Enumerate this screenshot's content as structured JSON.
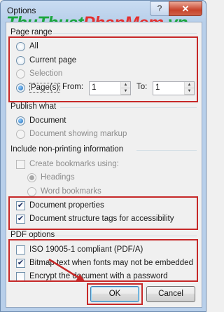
{
  "window": {
    "title": "Options",
    "help_glyph": "?",
    "close_glyph": "✕",
    "watermark_part1": "ThuThuat",
    "watermark_part2": "PhanMem",
    "watermark_part3": ".vn"
  },
  "page_range": {
    "title": "Page range",
    "all_label": "All",
    "current_page_label": "Current page",
    "selection_label": "Selection",
    "pages_label": "Page(s)",
    "from_label": "From:",
    "from_value": "1",
    "to_label": "To:",
    "to_value": "1",
    "selected": "pages"
  },
  "publish_what": {
    "title": "Publish what",
    "document_label": "Document",
    "markup_label": "Document showing markup"
  },
  "non_printing": {
    "title": "Include non-printing information",
    "bookmarks_label": "Create bookmarks using:",
    "headings_label": "Headings",
    "word_bookmarks_label": "Word bookmarks",
    "doc_properties_label": "Document properties",
    "doc_properties_checked": true,
    "structure_tags_label": "Document structure tags for accessibility",
    "structure_tags_checked": true
  },
  "pdf_options": {
    "title": "PDF options",
    "iso_label": "ISO 19005-1 compliant (PDF/A)",
    "iso_checked": false,
    "bitmap_label": "Bitmap text when fonts may not be embedded",
    "bitmap_checked": true,
    "encrypt_label": "Encrypt the document with a password",
    "encrypt_checked": false
  },
  "buttons": {
    "ok_label": "OK",
    "cancel_label": "Cancel"
  },
  "glyphs": {
    "check": "✔",
    "up": "▲",
    "down": "▼"
  },
  "colors": {
    "highlight": "#c62828",
    "accent": "#1f6bb5",
    "watermark_green": "#1ba63e",
    "watermark_red": "#e3302f"
  }
}
